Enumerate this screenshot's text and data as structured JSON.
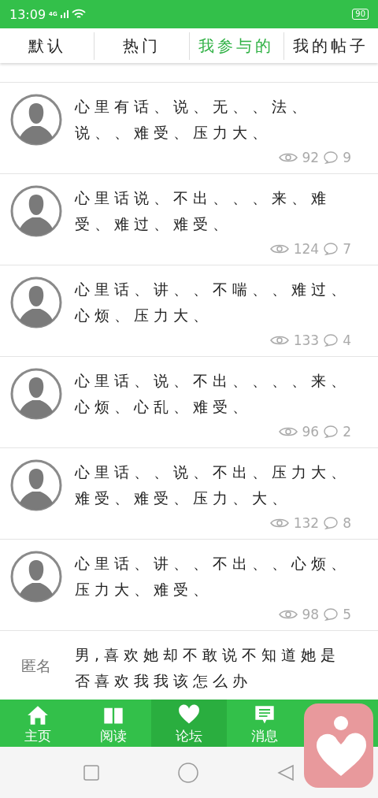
{
  "status_bar": {
    "time": "13:09",
    "network": "4G",
    "battery": "90"
  },
  "tabs": [
    {
      "label": "默认",
      "selected": false
    },
    {
      "label": "热门",
      "selected": false
    },
    {
      "label": "我参与的",
      "selected": true
    },
    {
      "label": "我的帖子",
      "selected": false
    }
  ],
  "posts": [
    {
      "kind": "avatar",
      "text": "心里有话、说、无、、法、说、、难受、压力大、",
      "views": "92",
      "comments": "9"
    },
    {
      "kind": "avatar",
      "text": "心里话说、不出、、、来、难受、难过、难受、",
      "views": "124",
      "comments": "7"
    },
    {
      "kind": "avatar",
      "text": "心里话、讲、、不喘、、难过、心烦、压力大、",
      "views": "133",
      "comments": "4"
    },
    {
      "kind": "avatar",
      "text": "心里话、说、不出、、、、来、心烦、心乱、难受、",
      "views": "96",
      "comments": "2"
    },
    {
      "kind": "avatar",
      "text": "心里话、、说、不出、压力大、难受、难受、压力、大、",
      "views": "132",
      "comments": "8"
    },
    {
      "kind": "avatar",
      "text": "心里话、讲、、不出、、心烦、压力大、难受、",
      "views": "98",
      "comments": "5"
    },
    {
      "kind": "anonymous",
      "author": "匿名",
      "text": "男,喜欢她却不敢说不知道她是否喜欢我我该怎么办"
    }
  ],
  "bottom_nav": [
    {
      "kind": "home",
      "label": "主页",
      "selected": false
    },
    {
      "kind": "read",
      "label": "阅读",
      "selected": false
    },
    {
      "kind": "forum",
      "label": "论坛",
      "selected": true
    },
    {
      "kind": "message",
      "label": "消息",
      "selected": false
    }
  ]
}
